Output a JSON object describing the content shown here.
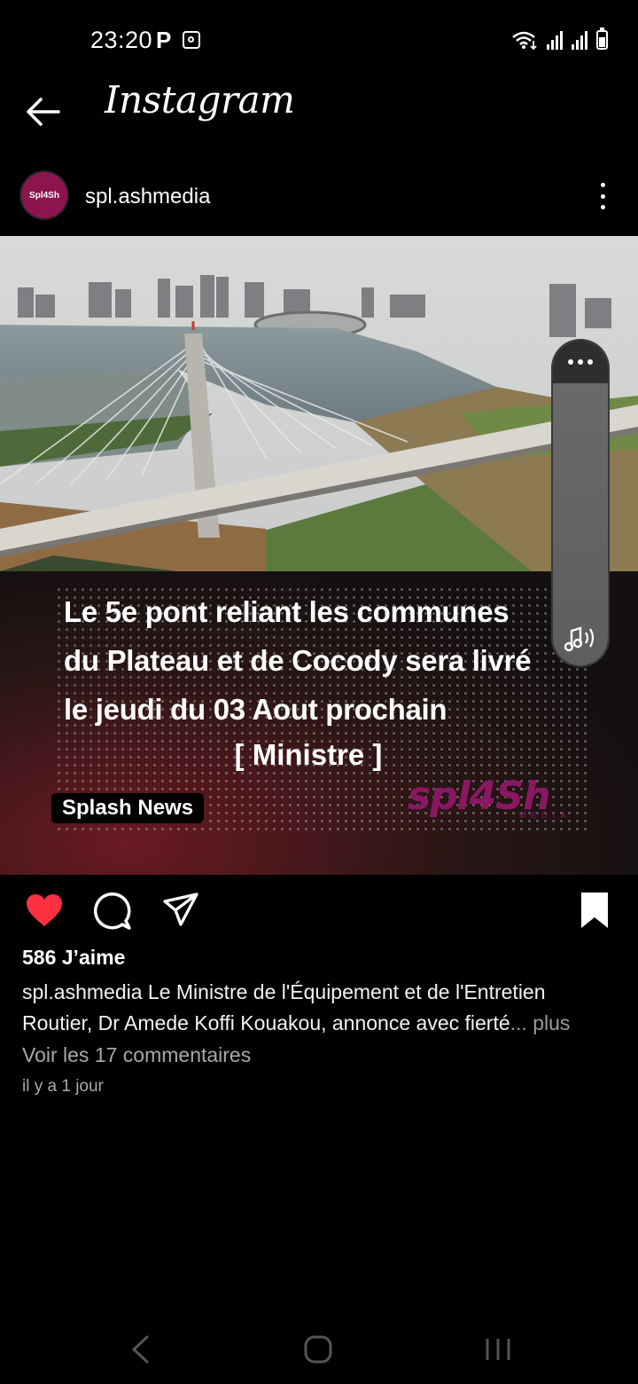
{
  "status_bar": {
    "time": "23:20",
    "notification_letter": "P",
    "icons": [
      "screenshot-icon",
      "wifi-icon",
      "signal-icon",
      "signal-icon",
      "battery-icon"
    ]
  },
  "header": {
    "title": "Instagram",
    "back_icon": "arrow-left-icon"
  },
  "post": {
    "username": "spl.ashmedia",
    "avatar_text": "Spl4Sh",
    "image": {
      "headline_lines": [
        "Le 5e pont reliant les communes",
        "du Plateau et de Cocody sera  livré",
        "le jeudi du 03 Aout prochain"
      ],
      "ministre": "[ Ministre ]",
      "badge": "Splash News",
      "brand": "spl4Sh",
      "brand_sub": "MEDIA"
    },
    "likes": "586 J’aime",
    "caption_user": "spl.ashmedia",
    "caption_text": " Le Ministre de l'Équipement et de l'Entretien Routier, Dr Amede Koffi Kouakou, annonce avec fierté",
    "caption_more": "... plus",
    "view_comments": "Voir les 17 commentaires",
    "timestamp": "il y a 1 jour"
  },
  "actions": [
    "heart-icon",
    "comment-icon",
    "send-icon",
    "bookmark-icon"
  ],
  "colors": {
    "background": "#000000",
    "like_red": "#ff3040",
    "brand_magenta": "#8a1762",
    "muted_text": "#a8a8a8"
  }
}
